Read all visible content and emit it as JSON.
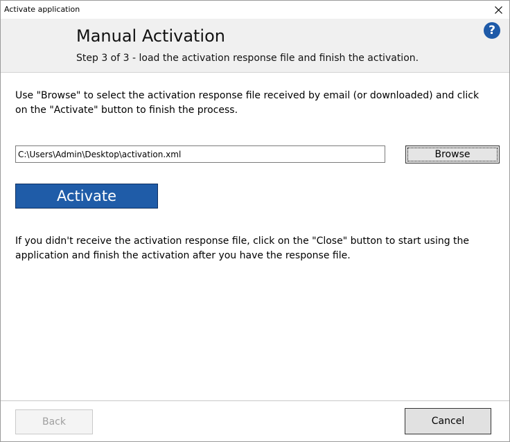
{
  "window": {
    "title": "Activate application",
    "close_glyph": "✕"
  },
  "header": {
    "title": "Manual Activation",
    "subtitle": "Step 3 of 3 - load the activation response file and finish the activation.",
    "help_glyph": "?"
  },
  "body": {
    "intro_text": "Use \"Browse\" to select the activation response file received by email (or downloaded) and click on the \"Activate\" button to finish the process.",
    "file_path": "C:\\Users\\Admin\\Desktop\\activation.xml",
    "browse_label": "Browse",
    "activate_label": "Activate",
    "note_text": "If you didn't receive the activation response file, click on the \"Close\" button to start using the application and finish the activation after you have the response file."
  },
  "footer": {
    "back_label": "Back",
    "cancel_label": "Cancel"
  },
  "icons": {
    "close": "close-icon",
    "help": "help-icon"
  },
  "colors": {
    "accent": "#1f5ca8",
    "header_bg": "#f0f0f0",
    "help_icon": "#1e5aa8"
  }
}
